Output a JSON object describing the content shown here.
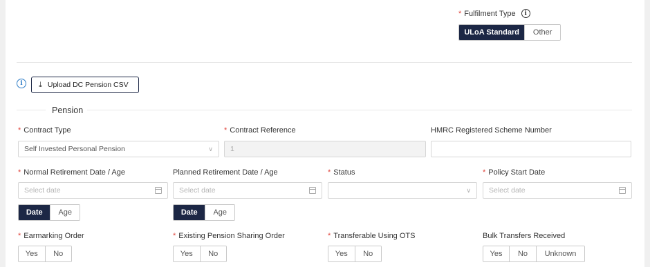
{
  "fulfilment": {
    "label": "Fulfilment Type",
    "options": [
      "ULoA Standard",
      "Other"
    ],
    "selected": "ULoA Standard"
  },
  "upload_button": "Upload DC Pension CSV",
  "section_title": "Pension",
  "fields": {
    "contract_type": {
      "label": "Contract Type",
      "value": "Self Invested Personal Pension"
    },
    "contract_reference": {
      "label": "Contract Reference",
      "value": "1"
    },
    "hmrc_scheme": {
      "label": "HMRC Registered Scheme Number",
      "value": ""
    },
    "normal_retirement": {
      "label": "Normal Retirement Date / Age",
      "placeholder": "Select date"
    },
    "planned_retirement": {
      "label": "Planned Retirement Date / Age",
      "placeholder": "Select date"
    },
    "status": {
      "label": "Status",
      "value": ""
    },
    "policy_start": {
      "label": "Policy Start Date",
      "placeholder": "Select date"
    }
  },
  "date_age_toggle": {
    "options": [
      "Date",
      "Age"
    ],
    "selected": "Date"
  },
  "earmarking": {
    "label": "Earmarking Order",
    "options": [
      "Yes",
      "No"
    ]
  },
  "pension_sharing": {
    "label": "Existing Pension Sharing Order",
    "options": [
      "Yes",
      "No"
    ]
  },
  "ots": {
    "label": "Transferable Using OTS",
    "options": [
      "Yes",
      "No"
    ]
  },
  "bulk_transfers": {
    "label": "Bulk Transfers Received",
    "options": [
      "Yes",
      "No",
      "Unknown"
    ]
  },
  "colors": {
    "primary": "#1c2745",
    "required": "#e0433b",
    "info": "#2d7cc7"
  }
}
